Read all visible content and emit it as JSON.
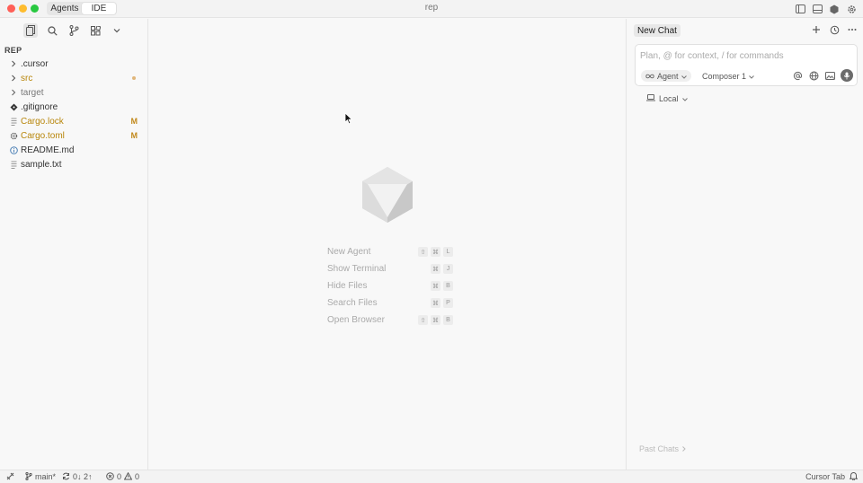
{
  "window": {
    "title": "rep",
    "modes": [
      "Agents",
      "IDE"
    ],
    "active_mode": "IDE"
  },
  "explorer": {
    "title": "REP",
    "items": [
      {
        "label": ".cursor",
        "kind": "folder",
        "state": "normal"
      },
      {
        "label": "src",
        "kind": "folder",
        "state": "modified"
      },
      {
        "label": "target",
        "kind": "folder",
        "state": "dim"
      },
      {
        "label": ".gitignore",
        "kind": "git",
        "state": "normal"
      },
      {
        "label": "Cargo.lock",
        "kind": "file",
        "state": "modified",
        "badge": "M"
      },
      {
        "label": "Cargo.toml",
        "kind": "gear",
        "state": "modified",
        "badge": "M"
      },
      {
        "label": "README.md",
        "kind": "info",
        "state": "normal"
      },
      {
        "label": "sample.txt",
        "kind": "file",
        "state": "normal"
      }
    ]
  },
  "shortcuts": [
    {
      "label": "New Agent",
      "keys": [
        "⇧",
        "⌘",
        "L"
      ]
    },
    {
      "label": "Show Terminal",
      "keys": [
        "⌘",
        "J"
      ]
    },
    {
      "label": "Hide Files",
      "keys": [
        "⌘",
        "B"
      ]
    },
    {
      "label": "Search Files",
      "keys": [
        "⌘",
        "P"
      ]
    },
    {
      "label": "Open Browser",
      "keys": [
        "⇧",
        "⌘",
        "B"
      ]
    }
  ],
  "chat": {
    "tab_label": "New Chat",
    "placeholder": "Plan, @ for context, / for commands",
    "agent_label": "Agent",
    "model_label": "Composer 1",
    "environment_label": "Local",
    "past_chats_label": "Past Chats"
  },
  "status": {
    "branch": "main*",
    "sync": "0↓ 2↑",
    "errors": "0",
    "warnings": "0",
    "right_label": "Cursor Tab"
  },
  "colors": {
    "modified": "#b8860b",
    "accent_close": "#ff5f57",
    "accent_min": "#febc2e",
    "accent_max": "#28c840"
  }
}
